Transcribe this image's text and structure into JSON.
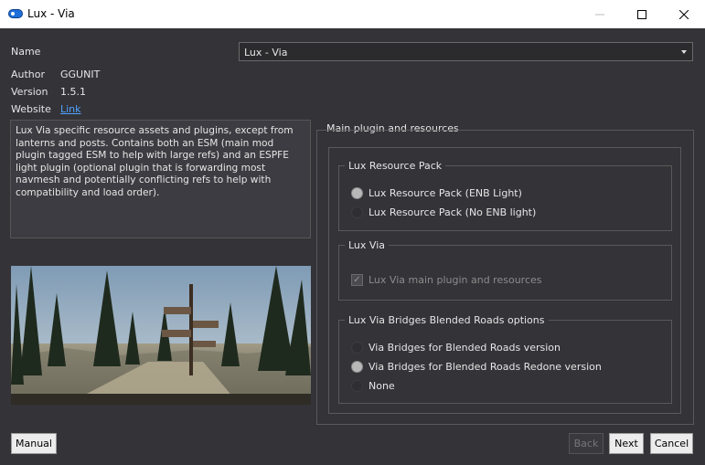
{
  "window": {
    "title": "Lux - Via"
  },
  "info": {
    "name_label": "Name",
    "name_value": "Lux - Via",
    "author_label": "Author",
    "author_value": "GGUNIT",
    "version_label": "Version",
    "version_value": "1.5.1",
    "website_label": "Website",
    "website_link": "Link",
    "description": "Lux Via specific resource assets and plugins, except from lanterns and posts. Contains both an ESM (main mod plugin tagged ESM to help with large refs) and an ESPFE light plugin (optional plugin that is forwarding most navmesh and potentially conflicting refs to help with compatibility and load order)."
  },
  "main_group": {
    "title": "Main plugin and resources"
  },
  "groups": [
    {
      "title": "Lux Resource Pack",
      "options": [
        {
          "label": "Lux Resource Pack (ENB Light)",
          "selected": true
        },
        {
          "label": "Lux Resource Pack (No ENB light)",
          "selected": false
        }
      ]
    },
    {
      "title": "Lux Via",
      "options": [
        {
          "label": "Lux Via main plugin and resources",
          "checked": true,
          "disabled": true
        }
      ]
    },
    {
      "title": "Lux Via Bridges Blended Roads options",
      "options": [
        {
          "label": "Via Bridges for Blended Roads version",
          "selected": false
        },
        {
          "label": "Via Bridges for Blended Roads Redone version",
          "selected": true
        },
        {
          "label": "None",
          "selected": false
        }
      ]
    }
  ],
  "buttons": {
    "manual": "Manual",
    "back": "Back",
    "next": "Next",
    "cancel": "Cancel"
  }
}
